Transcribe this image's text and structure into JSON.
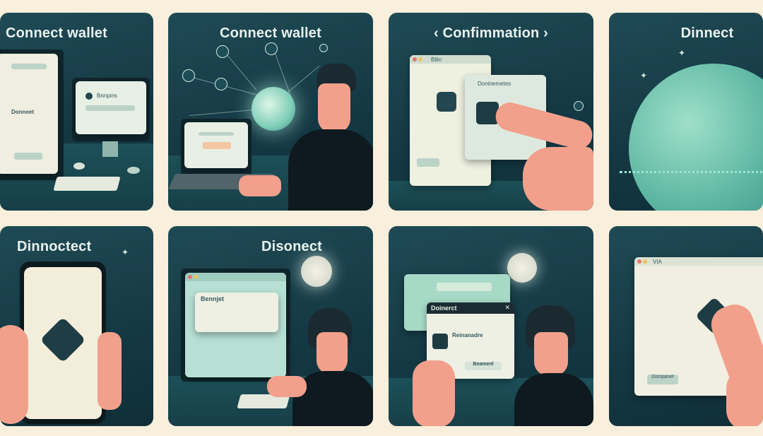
{
  "panels": [
    {
      "title": "Connect wallet",
      "screen_text": "Donneet",
      "window_label": "Bnnpins"
    },
    {
      "title": "Connect wallet"
    },
    {
      "title": "‹ Confimmation ›",
      "window_label": "Bllin",
      "popup_label": "Doninemetes"
    },
    {
      "title": "Dinnect"
    },
    {
      "title": "Dinnoctect"
    },
    {
      "title": "Disonect",
      "window_label": "Bennjet"
    },
    {
      "title": "",
      "dialog_title": "Doinerct",
      "dialog_label": "Reinanadre",
      "dialog_button": "Beamenl"
    },
    {
      "title": "",
      "window_label": "VIA",
      "button_label": "Disnpanet"
    }
  ],
  "colors": {
    "background": "#f8efdc",
    "panel": "#1a4550",
    "accent": "#7fd4c0"
  }
}
